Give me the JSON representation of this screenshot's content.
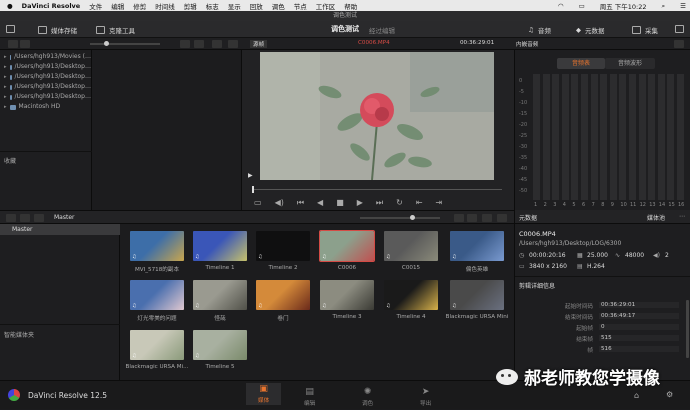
{
  "menubar": {
    "app": "DaVinci Resolve",
    "items": [
      "文件",
      "编辑",
      "修剪",
      "时间线",
      "剪辑",
      "标志",
      "显示",
      "回放",
      "调色",
      "节点",
      "工作区",
      "帮助"
    ],
    "clock": "周五 下午10:22"
  },
  "window_title": "调色测试",
  "toolbar": {
    "media_pool": "媒体存储",
    "clone": "克隆工具",
    "project": "调色测试",
    "edited": "经过编辑",
    "audio": "音频",
    "metadata": "元数据",
    "capture": "采集"
  },
  "viewer": {
    "mode": "源帧",
    "clip": "C0006.MP4",
    "timecode": "00:36:29:01"
  },
  "audio_panel": {
    "title": "内嵌音频",
    "tab_meters": "音频表",
    "tab_wave": "音频波形",
    "channels": [
      "1",
      "2",
      "3",
      "4",
      "5",
      "6",
      "7",
      "8",
      "9",
      "10",
      "11",
      "12",
      "13",
      "14",
      "15",
      "16"
    ],
    "scale": [
      "0",
      "-5",
      "-10",
      "-15",
      "-20",
      "-25",
      "-30",
      "-35",
      "-40",
      "-45",
      "-50"
    ]
  },
  "library": {
    "paths": [
      "/Users/hgh913/Movies (…",
      "/Users/hgh913/Desktop…",
      "/Users/hgh913/Desktop…",
      "/Users/hgh913/Desktop…",
      "/Users/hgh913/Desktop…",
      "Macintosh HD"
    ],
    "favorites": "收藏"
  },
  "bin": {
    "name": "Master",
    "tree": "Master",
    "smart": "智能媒体夹"
  },
  "clips": [
    {
      "name": "MVI_5718的副本",
      "c1": "#3d6ea8",
      "c2": "#c9a64d"
    },
    {
      "name": "Timeline 1",
      "c1": "#3a56b8",
      "c2": "#c7c26a"
    },
    {
      "name": "Timeline 2",
      "c1": "#0f0f10",
      "c2": "#0f0f10"
    },
    {
      "name": "C0006",
      "c1": "#8ca08c",
      "c2": "#c05050"
    },
    {
      "name": "C0015",
      "c1": "#5a5a5a",
      "c2": "#8a8a7a"
    },
    {
      "name": "偏色英雄",
      "c1": "#3a5a88",
      "c2": "#7a9ad0"
    },
    {
      "name": "灯光零美的问题",
      "c1": "#4a6fae",
      "c2": "#e0c8d0"
    },
    {
      "name": "怪哉",
      "c1": "#9a9a90",
      "c2": "#505048"
    },
    {
      "name": "卷门",
      "c1": "#d48a3a",
      "c2": "#6b2a1a"
    },
    {
      "name": "Timeline 3",
      "c1": "#8c8c80",
      "c2": "#3a3a34"
    },
    {
      "name": "Timeline 4",
      "c1": "#1a1a1a",
      "c2": "#d8b24a"
    },
    {
      "name": "Blackmagic URSA Mini",
      "c1": "#4a4a4a",
      "c2": "#6a7080"
    },
    {
      "name": "Blackmagic URSA Mi...",
      "c1": "#c8c8b8",
      "c2": "#8a9a7a"
    },
    {
      "name": "Timeline 5",
      "c1": "#a8b0a0",
      "c2": "#7a8a6a"
    }
  ],
  "metadata": {
    "title": "元数据",
    "pool": "媒体池",
    "clip": "C0006.MP4",
    "path": "/Users/hgh913/Desktop/LOG/6300",
    "duration": "00:00:20:16",
    "fps": "25.000",
    "rate": "48000",
    "channels": "2",
    "res": "3840 x 2160",
    "codec": "H.264",
    "details_title": "剪辑详细信息",
    "rows": [
      {
        "k": "起始时间码",
        "v": "00:36:29:01"
      },
      {
        "k": "结束时间码",
        "v": "00:36:49:17"
      },
      {
        "k": "起始帧",
        "v": "0"
      },
      {
        "k": "结束帧",
        "v": "515"
      },
      {
        "k": "帧",
        "v": "516"
      }
    ]
  },
  "footer": {
    "app": "DaVinci Resolve 12.5",
    "pages": [
      {
        "label": "媒体",
        "active": true
      },
      {
        "label": "编辑",
        "active": false
      },
      {
        "label": "调色",
        "active": false
      },
      {
        "label": "导出",
        "active": false
      }
    ]
  },
  "watermark": "郝老师教您学摄像",
  "colors": {
    "accent": "#e8742e",
    "highlight": "#d44b45"
  }
}
